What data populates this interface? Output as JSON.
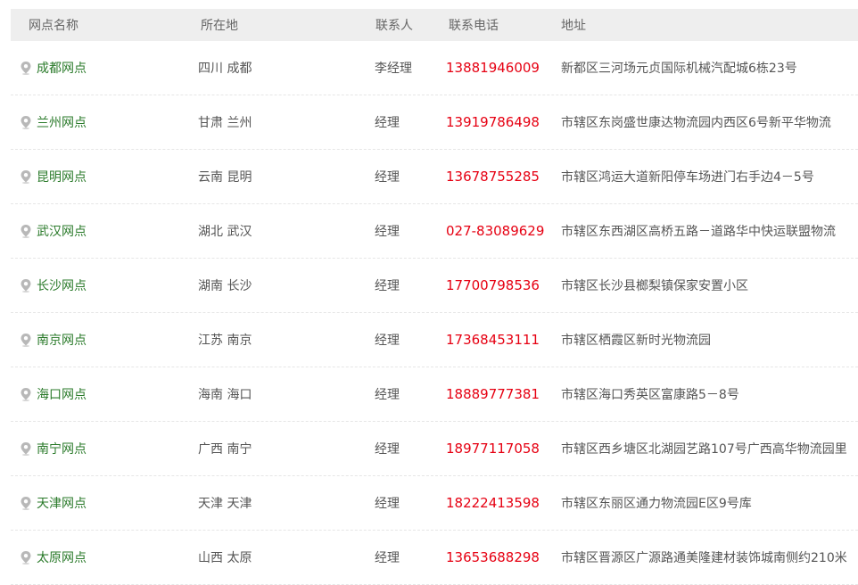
{
  "columns": {
    "name": "网点名称",
    "location": "所在地",
    "contact": "联系人",
    "phone": "联系电话",
    "address": "地址"
  },
  "icon": "map-pin-icon",
  "colors": {
    "name_text": "#2a7a2a",
    "phone_text": "#e60012",
    "header_bg": "#eeeeee"
  },
  "rows": [
    {
      "name": "成都网点",
      "location": "四川 成都",
      "contact": "李经理",
      "phone": "13881946009",
      "address": "新都区三河场元贞国际机械汽配城6栋23号"
    },
    {
      "name": "兰州网点",
      "location": "甘肃 兰州",
      "contact": "经理",
      "phone": "13919786498",
      "address": "市辖区东岗盛世康达物流园内西区6号新平华物流"
    },
    {
      "name": "昆明网点",
      "location": "云南 昆明",
      "contact": "经理",
      "phone": "13678755285",
      "address": "市辖区鸿运大道新阳停车场进门右手边4－5号"
    },
    {
      "name": "武汉网点",
      "location": "湖北 武汉",
      "contact": "经理",
      "phone": "027-83089629",
      "address": "市辖区东西湖区高桥五路－道路华中快运联盟物流"
    },
    {
      "name": "长沙网点",
      "location": "湖南 长沙",
      "contact": "经理",
      "phone": "17700798536",
      "address": "市辖区长沙县榔梨镇保家安置小区"
    },
    {
      "name": "南京网点",
      "location": "江苏 南京",
      "contact": "经理",
      "phone": "17368453111",
      "address": "市辖区栖霞区新时光物流园"
    },
    {
      "name": "海口网点",
      "location": "海南 海口",
      "contact": "经理",
      "phone": "18889777381",
      "address": "市辖区海口秀英区富康路5－8号"
    },
    {
      "name": "南宁网点",
      "location": "广西 南宁",
      "contact": "经理",
      "phone": "18977117058",
      "address": "市辖区西乡塘区北湖园艺路107号广西高华物流园里"
    },
    {
      "name": "天津网点",
      "location": "天津 天津",
      "contact": "经理",
      "phone": "18222413598",
      "address": "市辖区东丽区通力物流园E区9号库"
    },
    {
      "name": "太原网点",
      "location": "山西 太原",
      "contact": "经理",
      "phone": "13653688298",
      "address": "市辖区晋源区广源路通美隆建材装饰城南侧约210米"
    }
  ]
}
